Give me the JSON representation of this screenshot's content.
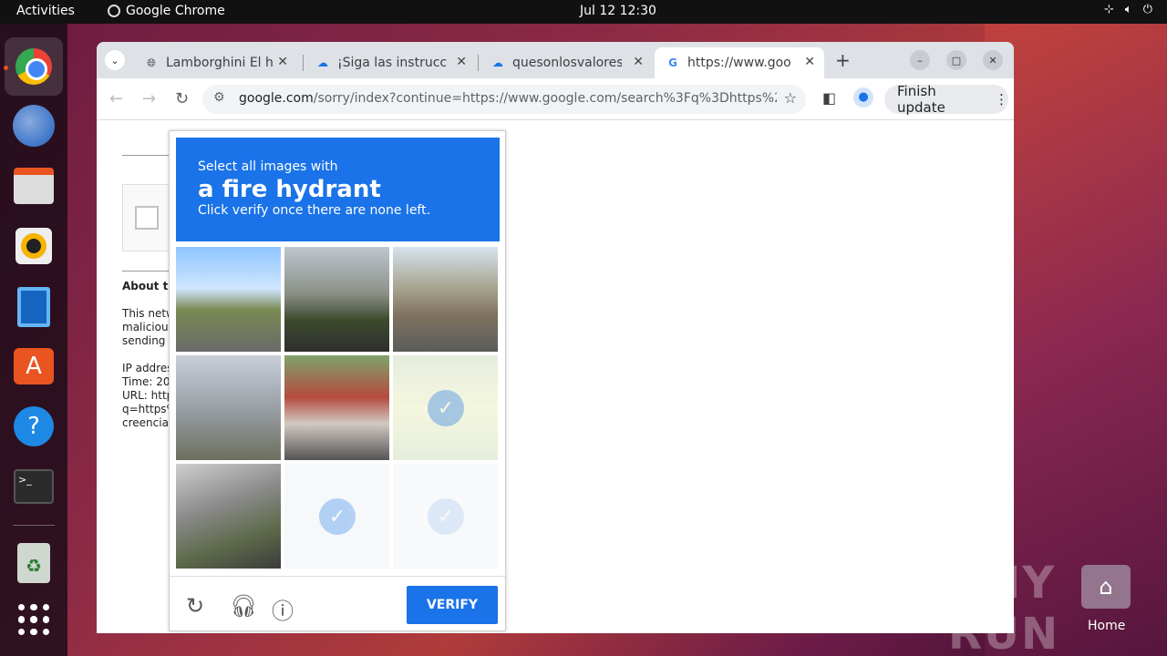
{
  "topbar": {
    "activities": "Activities",
    "app_name": "Google Chrome",
    "clock": "Jul 12  12:30"
  },
  "dock": {
    "items": [
      "chrome-icon",
      "thunderbird-icon",
      "files-icon",
      "rhythmbox-icon",
      "writer-icon",
      "software-icon",
      "help-icon",
      "terminal-icon",
      "trash-icon",
      "apps-grid-icon"
    ]
  },
  "browser": {
    "tabs": [
      {
        "title": "Lamborghini El h",
        "favicon": "globe-icon"
      },
      {
        "title": "¡Siga las instrucci",
        "favicon": "cloud-icon"
      },
      {
        "title": "quesonlosvalores",
        "favicon": "cloud-icon"
      },
      {
        "title": "https://www.goo",
        "favicon": "google-icon"
      }
    ],
    "url_host": "google.com",
    "url_path": "/sorry/index?continue=https://www.google.com/search%3Fq%3Dhttps%253A...",
    "finish_update": "Finish update"
  },
  "page": {
    "about": "About th",
    "lines": [
      "This netw",
      "malicious",
      "sending t",
      "",
      "IP addres",
      "Time: 20",
      "URL: http",
      "q=https%",
      "creencias"
    ]
  },
  "captcha": {
    "prompt_top": "Select all images with",
    "target": "a fire hydrant",
    "prompt_bottom": "Click verify once there are none left.",
    "verify_label": "VERIFY",
    "tiles": [
      {
        "label": "street-scene-1",
        "selected": false
      },
      {
        "label": "building-scene",
        "selected": false
      },
      {
        "label": "street-scene-2",
        "selected": false
      },
      {
        "label": "traffic-light-scene",
        "selected": false
      },
      {
        "label": "storefront-scene",
        "selected": false
      },
      {
        "label": "hydrant-scene",
        "selected": true
      },
      {
        "label": "bridge-scene",
        "selected": false
      },
      {
        "label": "empty-scene-1",
        "selected": true
      },
      {
        "label": "empty-scene-2",
        "selected": true
      }
    ]
  },
  "desktop": {
    "watermark": "ANY RUN",
    "home_label": "Home"
  }
}
